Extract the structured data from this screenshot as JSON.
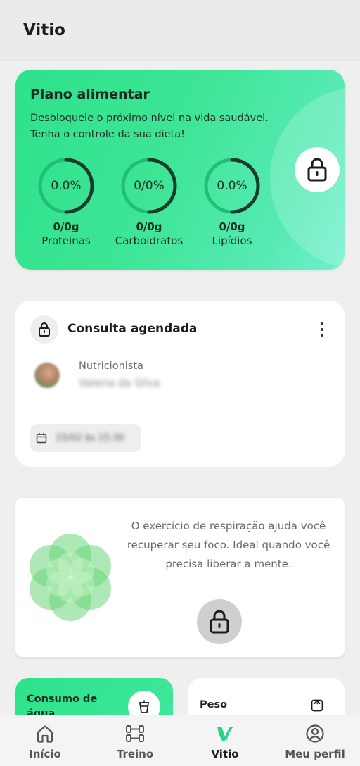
{
  "header": {
    "title": "Vitio"
  },
  "plano": {
    "title": "Plano alimentar",
    "description": "Desbloqueie o próximo nível na vida saudável. Tenha o controle da sua dieta!",
    "lock_icon": "lock-icon",
    "macros": [
      {
        "percent": "0.0%",
        "value": "0/0g",
        "label": "Proteinas"
      },
      {
        "percent": "0/0%",
        "value": "0/0g",
        "label": "Carboidratos"
      },
      {
        "percent": "0.0%",
        "value": "0/0g",
        "label": "Lipídios"
      }
    ]
  },
  "consulta": {
    "title": "Consulta agendada",
    "professional_label": "Nutricionista",
    "professional_name": "Valeria da Silva",
    "date": "15/02 às 15:30"
  },
  "breathing": {
    "description": "O exercício de respiração ajuda você recuperar seu foco. Ideal quando você precisa liberar a mente."
  },
  "agua": {
    "title": "Consumo de água"
  },
  "peso": {
    "title": "Peso"
  },
  "nav": {
    "items": [
      {
        "label": "Início",
        "icon": "home-icon"
      },
      {
        "label": "Treino",
        "icon": "dumbbell-icon"
      },
      {
        "label": "Vitio",
        "icon": "vitio-logo-icon"
      },
      {
        "label": "Meu perfil",
        "icon": "profile-icon"
      }
    ],
    "active": "Vitio"
  },
  "colors": {
    "brand_green": "#2ee28b",
    "ring_dark": "#1c3b2c",
    "nav_active": "#29d483"
  }
}
